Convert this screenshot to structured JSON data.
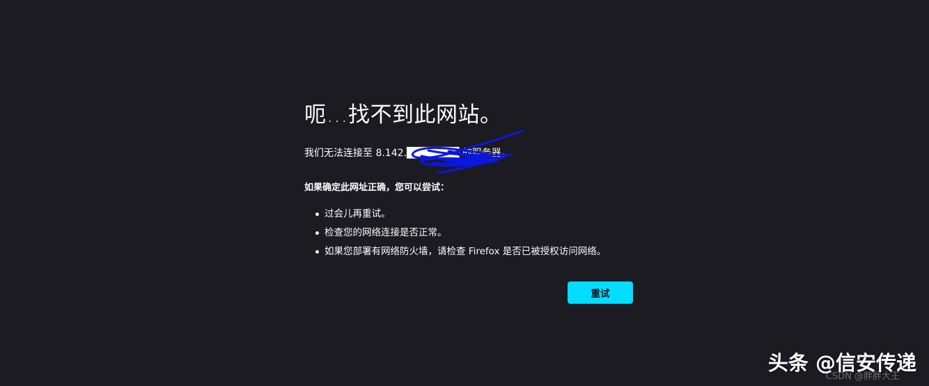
{
  "error_page": {
    "title": "呃…找不到此网站。",
    "description": "我们无法连接至 8.142.███████ 的服务器。",
    "suggestion_heading": "如果确定此网址正确，您可以尝试：",
    "suggestions": [
      "过会儿再重试。",
      "检查您的网络连接是否正常。",
      "如果您部署有网络防火墙，请检查 Firefox 是否已被授权访问网络。"
    ],
    "retry_label": "重试"
  },
  "watermark": {
    "label": "头条 @信安传递",
    "faint_label": "CSDN @胖胖大王"
  },
  "colors": {
    "background": "#1c1b22",
    "text": "#fbfbfe",
    "button_bg": "#00ddff",
    "button_text": "#15141a",
    "redaction_scribble": "#0a17e0"
  },
  "icons": {
    "bullet": "bullet-dot-icon"
  }
}
